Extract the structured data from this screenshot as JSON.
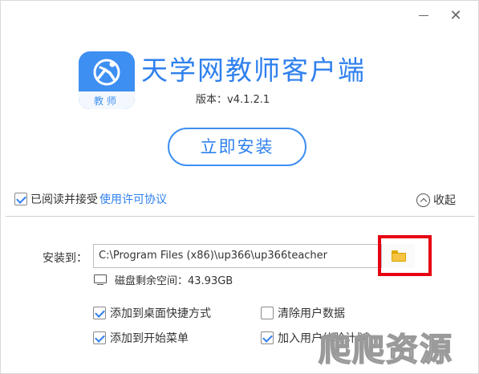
{
  "window": {
    "minimize_label": "—",
    "close_label": "✕"
  },
  "header": {
    "logo_text": "教师",
    "app_title": "天学网教师客户端",
    "version": "版本：v4.1.2.1"
  },
  "install_button": "立即安装",
  "agreement": {
    "checked": true,
    "text": "已阅读并接受",
    "link": "使用许可协议"
  },
  "collapse_label": "收起",
  "install_path": {
    "label": "安装到：",
    "value": "C:\\Program Files (x86)\\up366\\up366teacher",
    "browse_icon": "folder-icon"
  },
  "disk_space": "磁盘剩余空间：43.93GB",
  "options": {
    "desktop_shortcut": {
      "label": "添加到桌面快捷方式",
      "checked": true
    },
    "clear_user_data": {
      "label": "清除用户数据",
      "checked": false
    },
    "start_menu": {
      "label": "添加到开始菜单",
      "checked": true
    },
    "user_experience": {
      "label": "加入用户体验计划",
      "checked": true
    }
  },
  "watermark": "爬爬资源",
  "colors": {
    "accent": "#2f80ee",
    "highlight": "#e60012"
  }
}
